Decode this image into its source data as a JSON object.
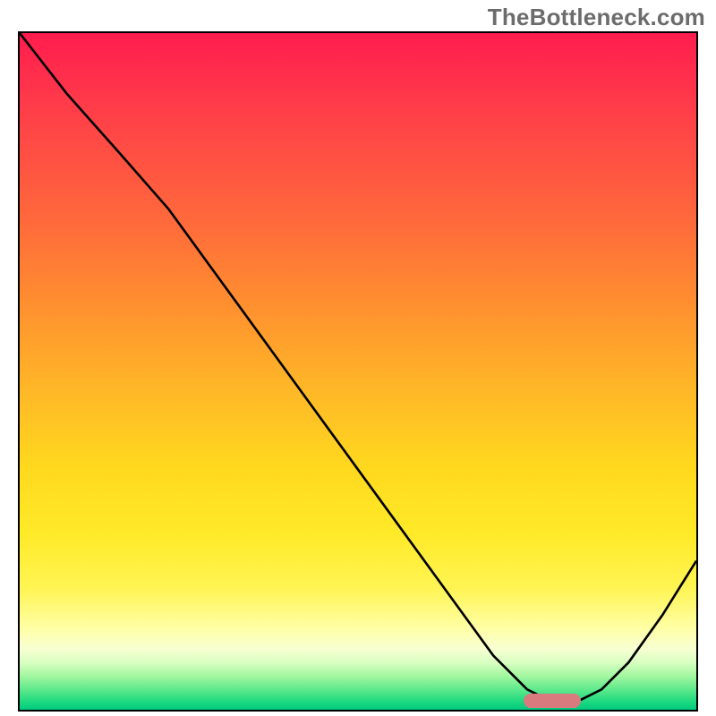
{
  "watermark": "TheBottleneck.com",
  "colors": {
    "gradient_top": "#ff1c4e",
    "gradient_bottom": "#00c97f",
    "curve": "#000000",
    "marker": "#d97a7f",
    "border": "#000000"
  },
  "chart_data": {
    "type": "line",
    "title": "",
    "xlabel": "",
    "ylabel": "",
    "xlim": [
      0,
      100
    ],
    "ylim": [
      0,
      100
    ],
    "grid": false,
    "legend": false,
    "background": "red-to-green vertical gradient",
    "series": [
      {
        "name": "bottleneck-curve",
        "x": [
          0,
          7,
          15,
          22,
          30,
          38,
          46,
          54,
          62,
          70,
          75,
          79,
          82,
          86,
          90,
          95,
          100
        ],
        "y": [
          100,
          91,
          82,
          74,
          63,
          52,
          41,
          30,
          19,
          8,
          3,
          1,
          1,
          3,
          7,
          14,
          22
        ]
      }
    ],
    "marker": {
      "x_start": 75,
      "x_end": 83,
      "y": 1.5,
      "note": "pink pill marker sitting at curve minimum"
    },
    "notes": "Axes have no visible tick labels; values are read off as percent of plot width/height."
  }
}
